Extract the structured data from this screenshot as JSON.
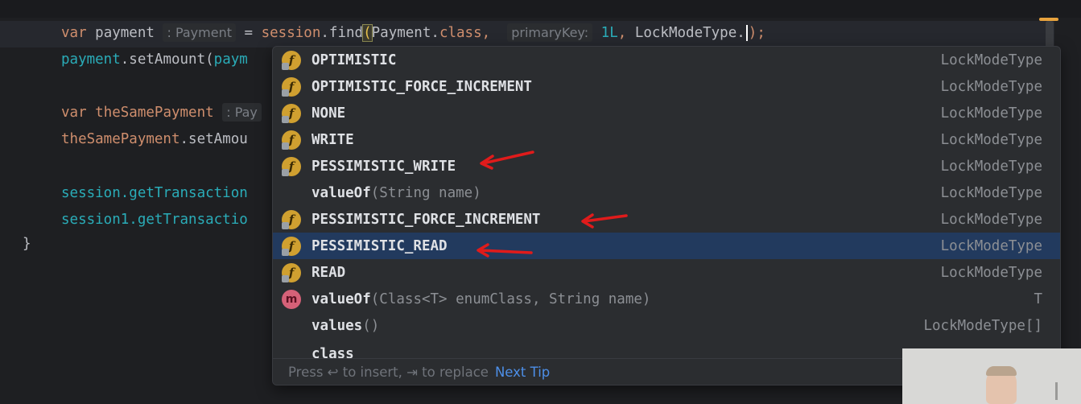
{
  "editor": {
    "line1": {
      "kw": "var",
      "name": "payment",
      "type_hint": ": Payment",
      "eq": " = ",
      "call_obj": "session",
      "call_dot": ".",
      "call_method": "find",
      "paren": "(",
      "cls": "Payment",
      "cls_suffix": ".",
      "class_kw": "class",
      "comma": ", ",
      "param_hint": "primaryKey:",
      "num": "1L",
      "comma2": ", ",
      "lock_type": "LockModeType.",
      "close": ");"
    },
    "line2": {
      "obj": "payment",
      "rest": ".setAmount(",
      "arg": "paym"
    },
    "line3": {
      "kw": "var",
      "name": "theSamePayment",
      "type_hint": ": Pay"
    },
    "line4": {
      "obj": "theSamePayment",
      "rest": ".setAmou"
    },
    "line5": {
      "text": "session.getTransaction"
    },
    "line6": {
      "text": "session1.getTransactio"
    },
    "brace": "}"
  },
  "completion": {
    "items": [
      {
        "name": "OPTIMISTIC",
        "params": "",
        "type": "LockModeType",
        "icon": "f"
      },
      {
        "name": "OPTIMISTIC_FORCE_INCREMENT",
        "params": "",
        "type": "LockModeType",
        "icon": "f"
      },
      {
        "name": "NONE",
        "params": "",
        "type": "LockModeType",
        "icon": "f"
      },
      {
        "name": "WRITE",
        "params": "",
        "type": "LockModeType",
        "icon": "f"
      },
      {
        "name": "PESSIMISTIC_WRITE",
        "params": "",
        "type": "LockModeType",
        "icon": "f"
      },
      {
        "name": "valueOf",
        "params": "(String name)",
        "type": "LockModeType",
        "icon": ""
      },
      {
        "name": "PESSIMISTIC_FORCE_INCREMENT",
        "params": "",
        "type": "LockModeType",
        "icon": "f"
      },
      {
        "name": "PESSIMISTIC_READ",
        "params": "",
        "type": "LockModeType",
        "icon": "f"
      },
      {
        "name": "READ",
        "params": "",
        "type": "LockModeType",
        "icon": "f"
      },
      {
        "name": "valueOf",
        "params": "(Class<T> enumClass, String name)",
        "type": "T",
        "icon": "m"
      },
      {
        "name": "values",
        "params": "()",
        "type": "LockModeType[]",
        "icon": ""
      },
      {
        "name": "class",
        "params": "",
        "type": "",
        "icon": ""
      }
    ],
    "selected_index": 7,
    "footer": {
      "text": "Press ↩ to insert, ⇥ to replace",
      "tip": "Next Tip"
    }
  },
  "colors": {
    "accent": "#4d8fe8",
    "selection": "#223a5e",
    "arrow": "#e01b1b"
  }
}
